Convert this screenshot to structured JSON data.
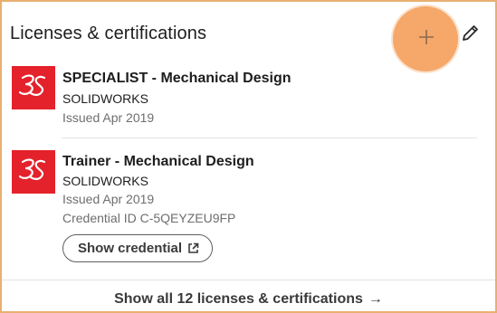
{
  "section": {
    "title": "Licenses & certifications",
    "add_icon": "plus-icon",
    "edit_icon": "pencil-icon"
  },
  "items": [
    {
      "title": "SPECIALIST - Mechanical Design",
      "issuer": "SOLIDWORKS",
      "issued": "Issued Apr 2019",
      "logo": "3ds-logo"
    },
    {
      "title": "Trainer - Mechanical Design",
      "issuer": "SOLIDWORKS",
      "issued": "Issued Apr 2019",
      "credential_id": "Credential ID C-5QEYZEU9FP",
      "show_credential_label": "Show credential",
      "logo": "3ds-logo"
    }
  ],
  "footer": {
    "show_all_label": "Show all 12 licenses & certifications",
    "arrow": "→"
  },
  "colors": {
    "logo_red": "#e4222b",
    "highlight": "#f5a86a",
    "frame_border": "#e8b070"
  }
}
